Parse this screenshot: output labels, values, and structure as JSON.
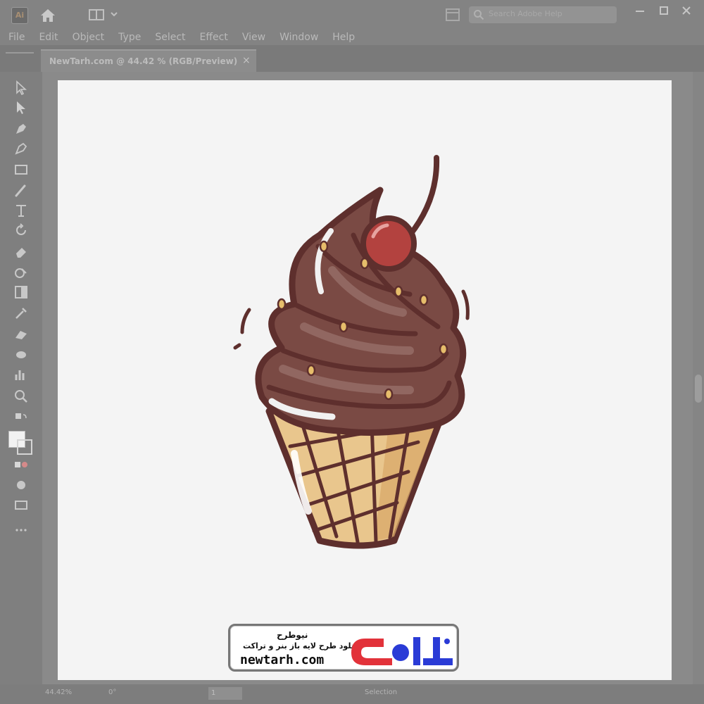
{
  "app": {
    "logo_label": "Ai",
    "search_placeholder": "Search Adobe Help"
  },
  "menu": {
    "items": [
      "File",
      "Edit",
      "Object",
      "Type",
      "Select",
      "Effect",
      "View",
      "Window",
      "Help"
    ]
  },
  "document": {
    "tab_label": "NewTarh.com @ 44.42 % (RGB/Preview)",
    "close_glyph": "×"
  },
  "status": {
    "zoom": "44.42%",
    "rotation": "0°",
    "page": "1",
    "tool": "Selection"
  },
  "watermark": {
    "title": "نیوطرح",
    "subtitle": "دانلود طرح لایه باز بنر و تراکت",
    "url": "newtarh.com",
    "logo_text": "نیوطرح"
  },
  "colors": {
    "chrome": "#838383",
    "artboard": "#f4f4f4",
    "chocolate": "#7a4a44",
    "outline": "#5e2f2d",
    "cone": "#e7c38a",
    "cherry": "#b3423f",
    "brand_red": "#e2323a",
    "brand_blue": "#2a3bd6"
  }
}
